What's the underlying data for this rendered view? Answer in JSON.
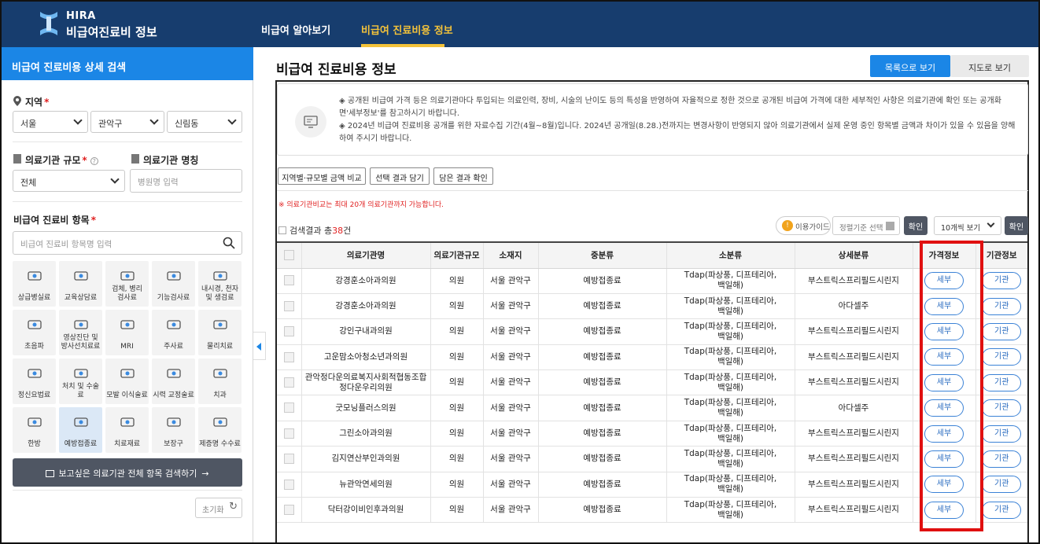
{
  "header": {
    "logo_top": "HIRA",
    "logo_main": "비급여진료비 정보",
    "nav": [
      "비급여 알아보기",
      "비급여 진료비용 정보"
    ]
  },
  "sidebar": {
    "title": "비급여 진료비용 상세 검색",
    "region_label": "지역",
    "region_req": "*",
    "region_selects": [
      "서울",
      "관악구",
      "신림동"
    ],
    "scale_label": "의료기관 규모",
    "scale_req": "*",
    "scale_value": "전체",
    "name_label": "의료기관 명칭",
    "name_placeholder": "병원명 입력",
    "item_label": "비급여 진료비 항목",
    "item_req": "*",
    "item_placeholder": "비급여 진료비 항목명 입력",
    "categories": [
      "상급병실료",
      "교육상담료",
      "검체, 병리\n검사료",
      "기능검사료",
      "내시경, 천자\n및 생검료",
      "초음파",
      "영상진단 및\n방사선치료료",
      "MRI",
      "주사료",
      "물리치료",
      "정신요법료",
      "처치 및 수술료",
      "모발 이식술료",
      "시력 교정술료",
      "치과",
      "한방",
      "예방접종료",
      "치료재료",
      "보장구",
      "제증명 수수료"
    ],
    "search_all": "보고싶은 의료기관 전체 항목 검색하기",
    "reset": "초기화"
  },
  "main": {
    "title": "비급여 진료비용 정보",
    "btn_list": "목록으로 보기",
    "btn_map": "지도로 보기",
    "notice": [
      "◈ 공개된 비급여 가격 등은 의료기관마다 투입되는 의료인력, 장비, 시술의 난이도 등의 특성을 반영하여 자율적으로 정한 것으로 공개된 비급여 가격에 대한 세부적인 사항은 의료기관에 확인 또는 공개화면'세부정보'를 참고하시기 바랍니다.",
      "◈ 2024년 비급여 진료비용 공개를 위한 자료수집 기간(4월~8월)입니다. 2024년 공개일(8.28.)전까지는 변경사항이 반영되지 않아 의료기관에서 실제 운영 중인 항목별 금액과 차이가 있을 수 있음을 양해하여 주시기 바랍니다."
    ],
    "tools": [
      "지역별·규모별 금액 비교",
      "선택 결과 담기",
      "담은 결과 확인"
    ],
    "warn": "※ 의료기관비교는 최대 20개 의료기관까지 가능합니다.",
    "result_prefix": "검색결과 총",
    "result_count": "38",
    "result_suffix": "건",
    "guide": "이용가이드",
    "sort": "정렬기준 선택",
    "ok": "확인",
    "perpage": "10개씩 보기",
    "columns": [
      "",
      "의료기관명",
      "의료기관규모",
      "소재지",
      "중분류",
      "소분류",
      "상세분류",
      "가격정보",
      "기관정보"
    ],
    "rows": [
      {
        "name": "강경훈소아과의원",
        "scale": "의원",
        "loc": "서울 관악구",
        "mid": "예방접종료",
        "sub": "Tdap(파상풍, 디프테리아, 백일해)",
        "detail": "부스트릭스프리필드시린지",
        "price": "세부",
        "org": "기관"
      },
      {
        "name": "강경훈소아과의원",
        "scale": "의원",
        "loc": "서울 관악구",
        "mid": "예방접종료",
        "sub": "Tdap(파상풍, 디프테리아, 백일해)",
        "detail": "아다셀주",
        "price": "세부",
        "org": "기관"
      },
      {
        "name": "강인구내과의원",
        "scale": "의원",
        "loc": "서울 관악구",
        "mid": "예방접종료",
        "sub": "Tdap(파상풍, 디프테리아, 백일해)",
        "detail": "부스트릭스프리필드시린지",
        "price": "세부",
        "org": "기관"
      },
      {
        "name": "고운맘소아청소년과의원",
        "scale": "의원",
        "loc": "서울 관악구",
        "mid": "예방접종료",
        "sub": "Tdap(파상풍, 디프테리아, 백일해)",
        "detail": "부스트릭스프리필드시린지",
        "price": "세부",
        "org": "기관"
      },
      {
        "name": "관악정다운의료복지사회적협동조합정다운우리의원",
        "scale": "의원",
        "loc": "서울 관악구",
        "mid": "예방접종료",
        "sub": "Tdap(파상풍, 디프테리아, 백일해)",
        "detail": "부스트릭스프리필드시린지",
        "price": "세부",
        "org": "기관"
      },
      {
        "name": "굿모닝플러스의원",
        "scale": "의원",
        "loc": "서울 관악구",
        "mid": "예방접종료",
        "sub": "Tdap(파상풍, 디프테리아, 백일해)",
        "detail": "아다셀주",
        "price": "세부",
        "org": "기관"
      },
      {
        "name": "그린소아과의원",
        "scale": "의원",
        "loc": "서울 관악구",
        "mid": "예방접종료",
        "sub": "Tdap(파상풍, 디프테리아, 백일해)",
        "detail": "부스트릭스프리필드시린지",
        "price": "세부",
        "org": "기관"
      },
      {
        "name": "김지연산부인과의원",
        "scale": "의원",
        "loc": "서울 관악구",
        "mid": "예방접종료",
        "sub": "Tdap(파상풍, 디프테리아, 백일해)",
        "detail": "부스트릭스프리필드시린지",
        "price": "세부",
        "org": "기관"
      },
      {
        "name": "뉴관악연세의원",
        "scale": "의원",
        "loc": "서울 관악구",
        "mid": "예방접종료",
        "sub": "Tdap(파상풍, 디프테리아, 백일해)",
        "detail": "부스트릭스프리필드시린지",
        "price": "세부",
        "org": "기관"
      },
      {
        "name": "닥터강이비인후과의원",
        "scale": "의원",
        "loc": "서울 관악구",
        "mid": "예방접종료",
        "sub": "Tdap(파상풍, 디프테리아, 백일해)",
        "detail": "부스트릭스프리필드시린지",
        "price": "세부",
        "org": "기관"
      }
    ]
  },
  "colors": {
    "header": "#173d6e",
    "accent": "#1b86e6",
    "active_nav": "#f3c23a",
    "highlight": "#e01010"
  }
}
